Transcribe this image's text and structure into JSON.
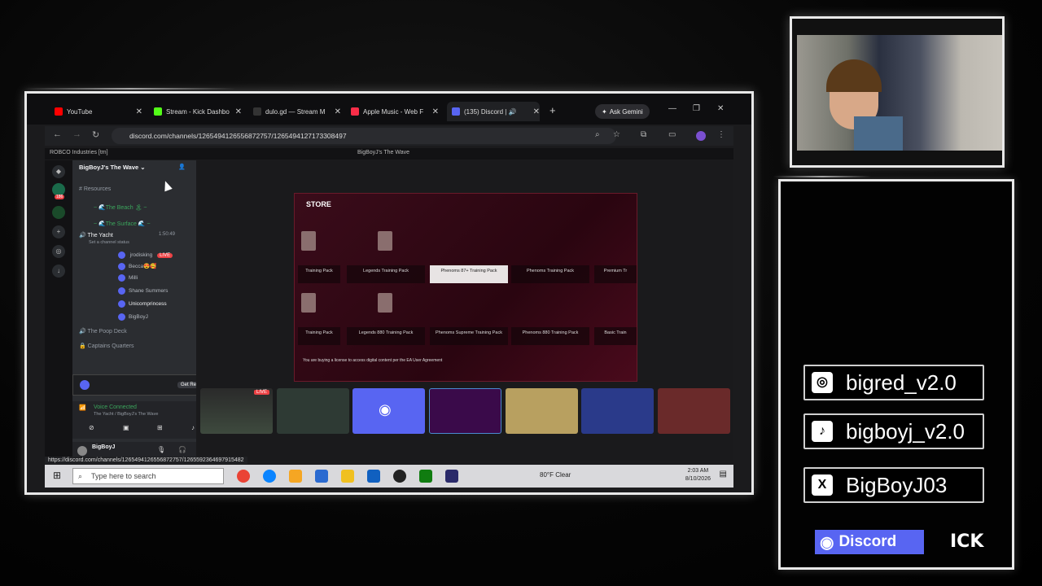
{
  "browser": {
    "tabs": [
      {
        "label": "YouTube",
        "color": "#ff0000"
      },
      {
        "label": "Stream - Kick Dashbo",
        "color": "#53fc18"
      },
      {
        "label": "dulo.gd — Stream M",
        "color": "#333333"
      },
      {
        "label": "Apple Music - Web F",
        "color": "#fa2d48"
      },
      {
        "label": "(135) Discord | 🔊",
        "color": "#5865f2"
      }
    ],
    "new_tab_glyph": "+",
    "gemini_label": "Ask Gemini",
    "url": "discord.com/channels/1265494126556872757/1265494127173308497",
    "status_url": "https://discord.com/channels/1265494126556872757/1265592364697915482"
  },
  "discord": {
    "top_left": "ROBCO Industries [tm]",
    "top_center": "BigBoyJ's The Wave",
    "server_name": "BigBoyJ's The Wave",
    "badge_count": "186",
    "channels": [
      {
        "name": "# Resources"
      },
      {
        "name": "~ 🌊The Beach 🏝 ~"
      },
      {
        "name": "~ 🌊The Surface 🌊 ~"
      }
    ],
    "voice_channel": "The Yacht",
    "voice_status": "Set a channel status",
    "voice_timer": "1:50:49",
    "members": [
      "jrodisking",
      "Becca😍🥰",
      "Milli",
      "Shane Summers",
      "Unicornprincess",
      "BigBoyJ"
    ],
    "live_label": "LIVE",
    "other_channels": [
      "The Poop Deck",
      "Captains Quarters"
    ],
    "promo_label": "Get Reward",
    "voice_connected": "Voice Connected",
    "voice_connected_sub": "The Yacht / BigBoyJ's The Wave",
    "username": "BigBoyJ"
  },
  "store": {
    "title": "STORE",
    "row1": [
      "Training Pack",
      "Legends Training Pack",
      "Phenoms 87+ Training Pack",
      "Phenoms Training Pack",
      "Premium Tr"
    ],
    "row2": [
      "Training Pack",
      "Legends 880 Training Pack",
      "Phenoms Supreme Training Pack",
      "Phenoms 880 Training Pack",
      "Basic Train"
    ],
    "notice": "You are buying a license to access digital content per the EA User Agreement"
  },
  "stream_live": "LIVE",
  "taskbar": {
    "search_placeholder": "Type here to search",
    "weather": "80°F  Clear",
    "time": "2:03 AM",
    "date": "8/10/2026"
  },
  "socials": {
    "instagram": "bigred_v2.0",
    "tiktok": "bigboyj_v2.0",
    "x": "BigBoyJ03",
    "discord_label": "Discord",
    "kick_label": "ICK"
  },
  "colors": {
    "discord_blurple": "#5865f2",
    "kick_green": "#53fc18",
    "store_red": "#4a0a1c"
  }
}
